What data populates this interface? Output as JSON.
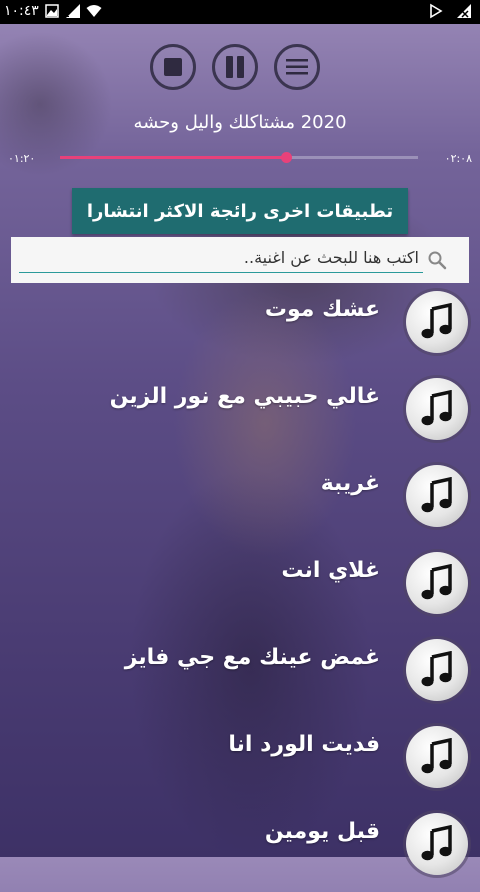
{
  "status_bar": {
    "time": "١٠:٤٣",
    "icons": [
      "image-icon",
      "signal-icon",
      "wifi-icon",
      "play-store-icon",
      "no-sim-icon"
    ]
  },
  "controls": {
    "stop_icon": "stop-icon",
    "pause_icon": "pause-icon",
    "menu_icon": "menu-icon"
  },
  "player": {
    "title": "2020 مشتاكلك واليل وحشه",
    "elapsed": "٠١:٢٠",
    "duration": "٠٢:٠٨",
    "progress": 0.63,
    "accent_color": "#e8417a"
  },
  "banner": {
    "label": "تطبيقات اخرى رائجة الاكثر انتشارا",
    "color": "#1f6c70"
  },
  "search": {
    "placeholder": "اكتب هنا للبحث عن اغنية..",
    "value": ""
  },
  "songs": [
    {
      "title": "عشك موت"
    },
    {
      "title": "غالي حبيبي مع نور الزين"
    },
    {
      "title": "غريبة"
    },
    {
      "title": "غلاي انت"
    },
    {
      "title": "غمض عينك مع جي فايز"
    },
    {
      "title": "فديت الورد انا"
    },
    {
      "title": "قبل يومين"
    }
  ]
}
